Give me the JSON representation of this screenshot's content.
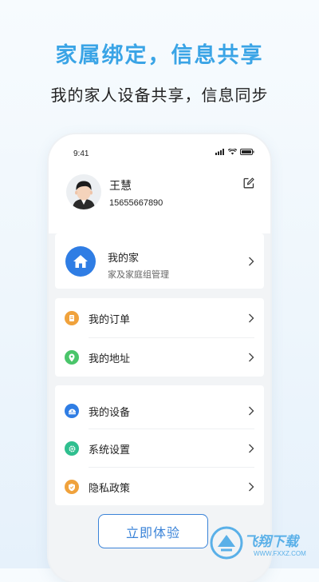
{
  "headline": "家属绑定，信息共享",
  "subline": "我的家人设备共享，信息同步",
  "status_bar": {
    "time": "9:41"
  },
  "profile": {
    "name": "王慧",
    "phone": "15655667890"
  },
  "home": {
    "title": "我的家",
    "subtitle": "家及家庭组管理",
    "icon": "house-icon"
  },
  "section1": [
    {
      "label": "我的订单",
      "icon": "order-icon",
      "color": "#f0a23c"
    },
    {
      "label": "我的地址",
      "icon": "location-icon",
      "color": "#4ac56a"
    }
  ],
  "section2": [
    {
      "label": "我的设备",
      "icon": "device-icon",
      "color": "#2f7de4"
    },
    {
      "label": "系统设置",
      "icon": "settings-icon",
      "color": "#2fbf8f"
    },
    {
      "label": "隐私政策",
      "icon": "shield-icon",
      "color": "#f0a23c"
    }
  ],
  "cta_button": "立即体验",
  "watermark": {
    "text": "飞翔下载",
    "url": "WWW.FXXZ.COM"
  }
}
